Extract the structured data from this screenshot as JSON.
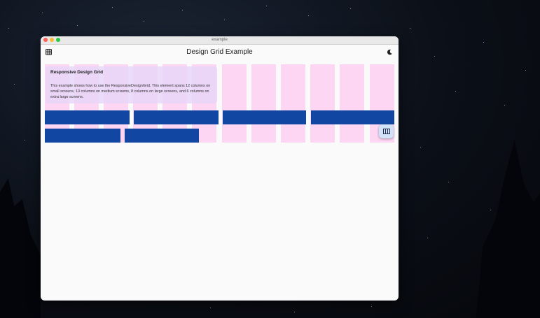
{
  "window": {
    "title": "example"
  },
  "appbar": {
    "title": "Design Grid Example",
    "left_icon": "grid-icon",
    "right_icon": "dark-mode-moon-icon"
  },
  "card": {
    "title": "Responsive Design Grid",
    "body": "This example shows how to use the ResponsiveDesignGrid. This element spans 12 columns on small screens, 10 columns on medium screens, 8 columns on large screens, and 6 columns on extra large screens."
  },
  "fab": {
    "icon": "view-column-icon"
  },
  "colors": {
    "column": "#fcd6f3",
    "bar": "#1147a2",
    "card": "#e7d6f8",
    "fab": "#d2e0f8"
  }
}
